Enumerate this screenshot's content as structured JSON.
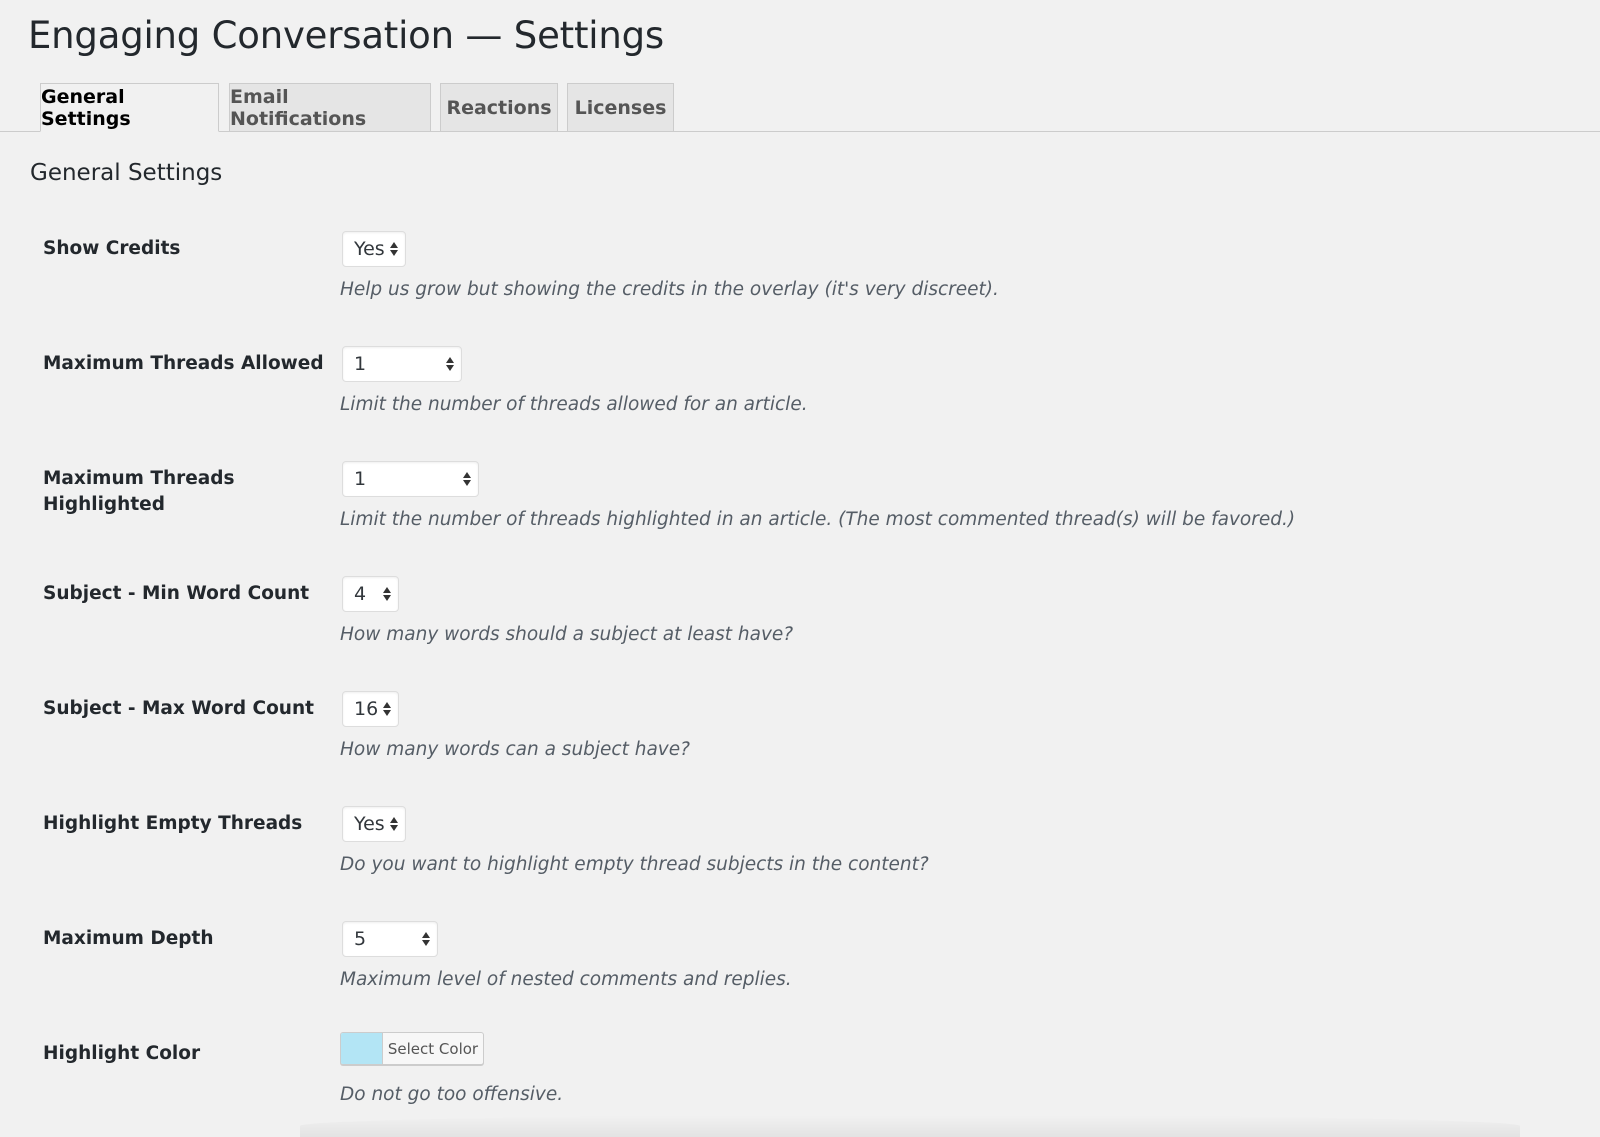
{
  "page": {
    "title": "Engaging Conversation — Settings"
  },
  "tabs": [
    {
      "label": "General Settings",
      "active": true
    },
    {
      "label": "Email Notifications",
      "active": false
    },
    {
      "label": "Reactions",
      "active": false
    },
    {
      "label": "Licenses",
      "active": false
    }
  ],
  "section": {
    "title": "General Settings"
  },
  "settings": [
    {
      "label": "Show Credits",
      "value": "Yes",
      "description": "Help us grow but showing the credits in the overlay (it's very discreet)."
    },
    {
      "label": "Maximum Threads Allowed",
      "value": "1",
      "description": "Limit the number of threads allowed for an article."
    },
    {
      "label": "Maximum Threads Highlighted",
      "value": "1",
      "description": "Limit the number of threads highlighted in an article. (The most commented thread(s) will be favored.)"
    },
    {
      "label": "Subject - Min Word Count",
      "value": "4",
      "description": "How many words should a subject at least have?"
    },
    {
      "label": "Subject - Max Word Count",
      "value": "16",
      "description": "How many words can a subject have?"
    },
    {
      "label": "Highlight Empty Threads",
      "value": "Yes",
      "description": "Do you want to highlight empty thread subjects in the content?"
    },
    {
      "label": "Maximum Depth",
      "value": "5",
      "description": "Maximum level of nested comments and replies."
    },
    {
      "label": "Highlight Color",
      "button_label": "Select Color",
      "swatch_color": "#b3e5f5",
      "description": "Do not go too offensive."
    }
  ],
  "icons": {
    "select_arrows": "up-down-arrows-icon"
  }
}
